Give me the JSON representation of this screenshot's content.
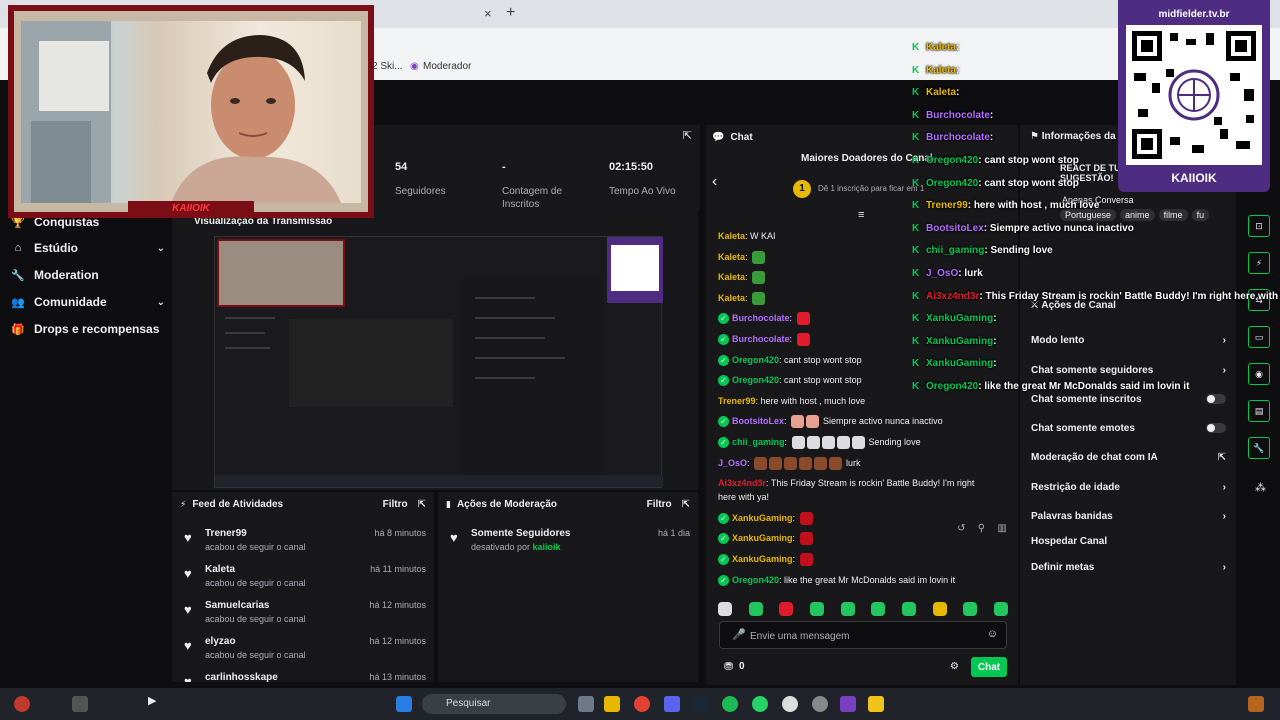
{
  "browser": {
    "close_tab": "×",
    "new_tab": "+",
    "bookmarks": [
      {
        "label": "2 Ski..."
      },
      {
        "label": "Moderador"
      }
    ]
  },
  "left_nav": {
    "items": [
      {
        "label": "Conquistas",
        "icon": "trophy-icon",
        "glyph": "🏆",
        "chevron": ""
      },
      {
        "label": "Estúdio",
        "icon": "studio-icon",
        "glyph": "⌂",
        "chevron": "⌄"
      },
      {
        "label": "Moderation",
        "icon": "wrench-icon",
        "glyph": "🔧",
        "chevron": ""
      },
      {
        "label": "Comunidade",
        "icon": "people-icon",
        "glyph": "👥",
        "chevron": "⌄"
      },
      {
        "label": "Drops e recompensas",
        "icon": "gift-icon",
        "glyph": "🎁",
        "chevron": ""
      }
    ]
  },
  "stats": {
    "followers_value": "54",
    "followers_label": "Seguidores",
    "subs_value": "-",
    "subs_label": "Contagem de Inscritos",
    "live_value": "02:15:50",
    "live_label": "Tempo Ao Vivo"
  },
  "preview": {
    "title": "Visualização da Transmissão"
  },
  "feed": {
    "title": "Feed de Atividades",
    "filter": "Filtro",
    "items": [
      {
        "name": "Trener99",
        "action": "acabou de seguir o canal",
        "time": "há 8 minutos"
      },
      {
        "name": "Kaleta",
        "action": "acabou de seguir o canal",
        "time": "há 11 minutos"
      },
      {
        "name": "Samuelcarias",
        "action": "acabou de seguir o canal",
        "time": "há 12 minutos"
      },
      {
        "name": "elyzao",
        "action": "acabou de seguir o canal",
        "time": "há 12 minutos"
      },
      {
        "name": "carlinhosskape",
        "action": "",
        "time": "há 13 minutos"
      }
    ]
  },
  "mod_feed": {
    "title": "Ações de Moderação",
    "filter": "Filtro",
    "items": [
      {
        "name": "Somente Seguidores",
        "action_prefix": "desativado por ",
        "by": "kaiioik",
        "time": "há 1 dia"
      }
    ]
  },
  "chat": {
    "title": "Chat",
    "donors_title": "Maiores Doadores do Canal",
    "donor_rank": "1",
    "donor_sub": "Dê 1 inscrição para ficar em 1",
    "messages": [
      {
        "user": "Kaleta",
        "color": "#e6b800",
        "verified": false,
        "text": "W KAI",
        "emotes": []
      },
      {
        "user": "Kaleta",
        "color": "#e6b800",
        "verified": false,
        "text": "",
        "emotes": [
          "#3a9b3a"
        ]
      },
      {
        "user": "Kaleta",
        "color": "#e6b800",
        "verified": false,
        "text": "",
        "emotes": [
          "#3a9b3a"
        ]
      },
      {
        "user": "Kaleta",
        "color": "#e6b800",
        "verified": false,
        "text": "",
        "emotes": [
          "#3a9b3a"
        ]
      },
      {
        "user": "Burchocolate",
        "color": "#b46cff",
        "verified": true,
        "text": "",
        "emotes": [
          "#e01c2c"
        ]
      },
      {
        "user": "Burchocolate",
        "color": "#b46cff",
        "verified": true,
        "text": "",
        "emotes": [
          "#e01c2c"
        ]
      },
      {
        "user": "Oregon420",
        "color": "#00c853",
        "verified": true,
        "text": "cant stop wont stop",
        "emotes": []
      },
      {
        "user": "Oregon420",
        "color": "#00c853",
        "verified": true,
        "text": "cant stop wont stop",
        "emotes": []
      },
      {
        "user": "Trener99",
        "color": "#e6b800",
        "verified": false,
        "text": "here with host , much love",
        "emotes": []
      },
      {
        "user": "BootsitoLex",
        "color": "#b46cff",
        "verified": true,
        "text": "Siempre activo nunca inactivo",
        "emotes": [
          "#e8a090",
          "#e8a090"
        ]
      },
      {
        "user": "chii_gaming",
        "color": "#00c853",
        "verified": true,
        "text": "Sending love",
        "emotes": [
          "#dddddd",
          "#dddddd",
          "#dddddd",
          "#dddddd",
          "#dddddd"
        ]
      },
      {
        "user": "J_OsO",
        "color": "#b46cff",
        "verified": false,
        "text": "lurk",
        "emotes": [
          "#8b4a2b",
          "#8b4a2b",
          "#8b4a2b",
          "#8b4a2b",
          "#8b4a2b",
          "#8b4a2b"
        ]
      },
      {
        "user": "Ai3xz4nd3r",
        "color": "#e01c2c",
        "verified": false,
        "text": "This Friday Stream is rockin' Battle Buddy! I'm right",
        "emotes": []
      },
      {
        "user": "",
        "color": "#efeff1",
        "verified": false,
        "text": "here with ya!",
        "emotes": []
      },
      {
        "user": "XankuGaming",
        "color": "#e6b800",
        "verified": true,
        "text": "",
        "emotes": [
          "#c0101e"
        ]
      },
      {
        "user": "XankuGaming",
        "color": "#e6b800",
        "verified": true,
        "text": "",
        "emotes": [
          "#c0101e"
        ]
      },
      {
        "user": "XankuGaming",
        "color": "#e6b800",
        "verified": true,
        "text": "",
        "emotes": [
          "#c0101e"
        ]
      },
      {
        "user": "Oregon420",
        "color": "#00c853",
        "verified": true,
        "text": "like the great Mr McDonalds said im lovin it",
        "emotes": []
      }
    ],
    "emote_bar": [
      "#dddddd",
      "#22c55e",
      "#e01c2c",
      "#22c55e",
      "#22c55e",
      "#22c55e",
      "#22c55e",
      "#e6b800",
      "#22c55e",
      "#22c55e"
    ],
    "input_placeholder": "Envie uma mensagem",
    "points": "0",
    "send_label": "Chat"
  },
  "mod_actions": {
    "title": "Ações de Canal",
    "info_title": "Informações da",
    "items": [
      {
        "label": "Modo lento",
        "type": "chevron"
      },
      {
        "label": "Chat somente seguidores",
        "type": "chevron"
      },
      {
        "label": "Chat somente inscritos",
        "type": "toggle"
      },
      {
        "label": "Chat somente emotes",
        "type": "toggle"
      },
      {
        "label": "Moderação de chat com IA",
        "type": "external"
      },
      {
        "label": "Restrição de idade",
        "type": "chevron"
      },
      {
        "label": "Palavras banidas",
        "type": "chevron"
      },
      {
        "label": "Hospedar Canal",
        "type": "none"
      },
      {
        "label": "Definir metas",
        "type": "chevron"
      }
    ],
    "info_tags": [
      "Portuguese",
      "anime",
      "filme",
      "fu"
    ],
    "info_category": "Apenas Conversa",
    "info_text": "REACT DE TUDO S SUGESTÃO!"
  },
  "overlay_chat": [
    {
      "user": "Kaleta",
      "text": ""
    },
    {
      "user": "Kaleta",
      "text": ""
    },
    {
      "user": "Kaleta",
      "text": ""
    },
    {
      "user": "Burchocolate",
      "text": ""
    },
    {
      "user": "Burchocolate",
      "text": ""
    },
    {
      "user": "Oregon420",
      "text": "cant stop wont stop"
    },
    {
      "user": "Oregon420",
      "text": "cant stop wont stop"
    },
    {
      "user": "Trener99",
      "text": "here with host , much love"
    },
    {
      "user": "BootsitoLex",
      "text": "Siempre activo nunca inactivo"
    },
    {
      "user": "chii_gaming",
      "text": "Sending love"
    },
    {
      "user": "J_OsO",
      "text": "lurk"
    },
    {
      "user": "Ai3xz4nd3r",
      "text": "This Friday Stream is rockin' Battle Buddy! I'm right here with y"
    },
    {
      "user": "XankuGaming",
      "text": ""
    },
    {
      "user": "XankuGaming",
      "text": ""
    },
    {
      "user": "XankuGaming",
      "text": ""
    },
    {
      "user": "Oregon420",
      "text": "like the great Mr McDonalds said im lovin it"
    }
  ],
  "overlay_user_colors": {
    "Kaleta": "#e6b800",
    "Burchocolate": "#b46cff",
    "Oregon420": "#00c853",
    "Trener99": "#e6b800",
    "BootsitoLex": "#b46cff",
    "chii_gaming": "#00c853",
    "J_OsO": "#b46cff",
    "Ai3xz4nd3r": "#e01c2c",
    "XankuGaming": "#00c853"
  },
  "qr": {
    "url": "midfielder.tv.br",
    "name": "KAIIOIK"
  },
  "webcam": {
    "tag": "KAIIOIK"
  },
  "taskbar": {
    "search_placeholder": "Pesquisar"
  },
  "colors": {
    "accent": "#00c853",
    "brand_purple": "#4d2c82",
    "frame_red": "#7a0d15"
  }
}
